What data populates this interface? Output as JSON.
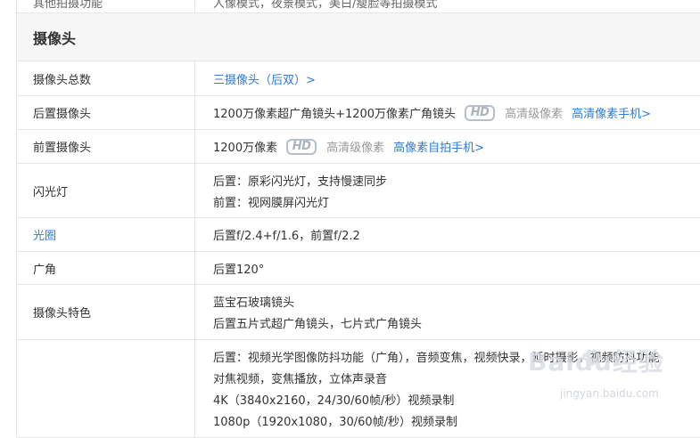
{
  "top_row": {
    "label": "其他拍摄功能",
    "value": "人像模式，夜景模式，美白/瘦脸等拍摄模式"
  },
  "section_title": "摄像头",
  "rows": {
    "camera_count": {
      "label": "摄像头总数",
      "value": "三摄像头（后双）>"
    },
    "rear_camera": {
      "label": "后置摄像头",
      "value": "1200万像素超广角镜头+1200万像素广角镜头",
      "hd_badge": "HD",
      "quality": "高清级像素",
      "link": "高清像素手机>"
    },
    "front_camera": {
      "label": "前置摄像头",
      "value": "1200万像素",
      "hd_badge": "HD",
      "quality": "高清级像素",
      "link": "高像素自拍手机>"
    },
    "flash": {
      "label": "闪光灯",
      "lines": [
        "后置：原彩闪光灯，支持慢速同步",
        "前置：视网膜屏闪光灯"
      ]
    },
    "aperture": {
      "label": "光圈",
      "value": "后置f/2.4+f/1.6，前置f/2.2"
    },
    "wide_angle": {
      "label": "广角",
      "value": "后置120°"
    },
    "camera_features": {
      "label": "摄像头特色",
      "lines": [
        "蓝宝石玻璃镜头",
        "后置五片式超广角镜头，七片式广角镜头"
      ]
    },
    "video": {
      "label": "",
      "lines": [
        "后置：视频光学图像防抖功能（广角），音频变焦，视频快录，延时摄影，视频防抖功能",
        "对焦视频，变焦播放，立体声录音",
        "4K（3840x2160，24/30/60帧/秒）视频录制",
        "1080p（1920x1080，30/60帧/秒）视频录制"
      ]
    }
  },
  "watermark": {
    "main": "Baidu经验",
    "sub": "jingyan.baidu.com"
  },
  "colors": {
    "link": "#2f7bd3",
    "muted": "#999999",
    "border": "#e6e6e6",
    "section_bg": "#f7f7f7"
  }
}
